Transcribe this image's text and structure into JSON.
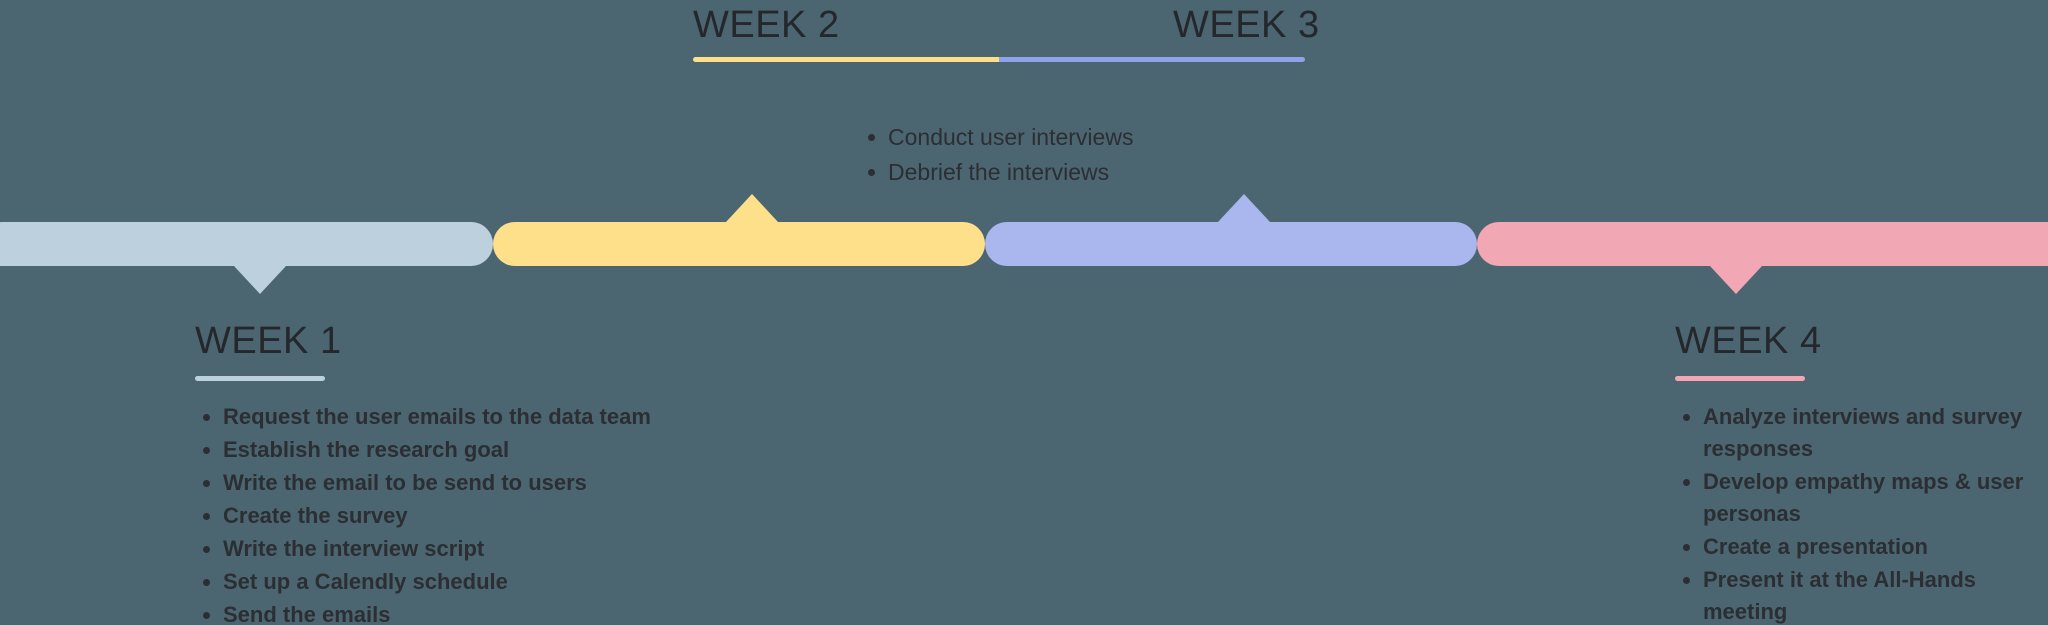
{
  "background_color": "#4c6671",
  "text_color": "#2b2e33",
  "timeline": {
    "segments": [
      {
        "week": "WEEK 1",
        "color": "#bcd0de",
        "arrow": "down"
      },
      {
        "week": "WEEK 2",
        "color": "#ffe08a",
        "arrow": "up"
      },
      {
        "week": "WEEK 3",
        "color": "#a9b7ee",
        "arrow": "up"
      },
      {
        "week": "WEEK 4",
        "color": "#f2a8b4",
        "arrow": "down"
      }
    ]
  },
  "top": {
    "week2_title": "WEEK 2",
    "week3_title": "WEEK 3",
    "rule_colors": {
      "left": "#ffe08a",
      "right": "#8fa3e8"
    },
    "bullets": [
      "Conduct user interviews",
      "Debrief the interviews"
    ]
  },
  "week1": {
    "title": "WEEK 1",
    "rule_color": "#bcd0de",
    "bullets": [
      "Request the user emails to the data team",
      "Establish the research goal",
      "Write the email to be send to users",
      "Create the survey",
      "Write the interview script",
      "Set up a Calendly schedule",
      "Send the emails"
    ]
  },
  "week4": {
    "title": "WEEK 4",
    "rule_color": "#f2a8b4",
    "bullets": [
      "Analyze interviews and survey responses",
      "Develop empathy maps & user personas",
      "Create a presentation",
      "Present it at the All-Hands meeting"
    ]
  }
}
